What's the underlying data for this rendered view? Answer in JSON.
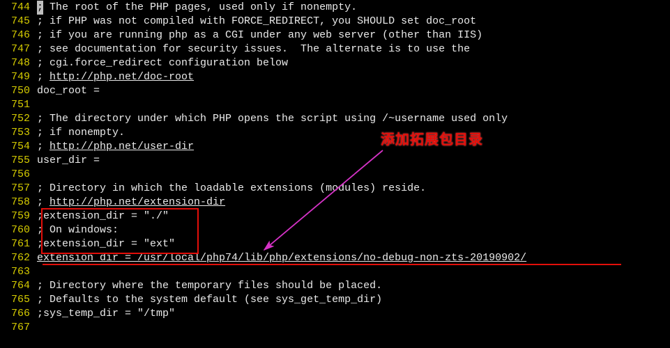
{
  "annotation": {
    "label": "添加拓展包目录"
  },
  "lines": [
    {
      "num": 744,
      "segments": [
        {
          "kind": "cursor",
          "text": ";"
        },
        {
          "kind": "comment",
          "text": " The root of the PHP pages, used only if nonempty."
        }
      ]
    },
    {
      "num": 745,
      "segments": [
        {
          "kind": "comment",
          "text": "; if PHP was not compiled with FORCE_REDIRECT, you SHOULD set doc_root"
        }
      ]
    },
    {
      "num": 746,
      "segments": [
        {
          "kind": "comment",
          "text": "; if you are running php as a CGI under any web server (other than IIS)"
        }
      ]
    },
    {
      "num": 747,
      "segments": [
        {
          "kind": "comment",
          "text": "; see documentation for security issues.  The alternate is to use the"
        }
      ]
    },
    {
      "num": 748,
      "segments": [
        {
          "kind": "comment",
          "text": "; cgi.force_redirect configuration below"
        }
      ]
    },
    {
      "num": 749,
      "segments": [
        {
          "kind": "comment",
          "text": "; "
        },
        {
          "kind": "link",
          "text": "http://php.net/doc-root"
        }
      ]
    },
    {
      "num": 750,
      "segments": [
        {
          "kind": "plain",
          "text": "doc_root ="
        }
      ]
    },
    {
      "num": 751,
      "segments": [
        {
          "kind": "plain",
          "text": ""
        }
      ]
    },
    {
      "num": 752,
      "segments": [
        {
          "kind": "comment",
          "text": "; The directory under which PHP opens the script using /~username used only"
        }
      ]
    },
    {
      "num": 753,
      "segments": [
        {
          "kind": "comment",
          "text": "; if nonempty."
        }
      ]
    },
    {
      "num": 754,
      "segments": [
        {
          "kind": "comment",
          "text": "; "
        },
        {
          "kind": "link",
          "text": "http://php.net/user-dir"
        }
      ]
    },
    {
      "num": 755,
      "segments": [
        {
          "kind": "plain",
          "text": "user_dir ="
        }
      ]
    },
    {
      "num": 756,
      "segments": [
        {
          "kind": "plain",
          "text": ""
        }
      ]
    },
    {
      "num": 757,
      "segments": [
        {
          "kind": "comment",
          "text": "; Directory in which the loadable extensions (modules) reside."
        }
      ]
    },
    {
      "num": 758,
      "segments": [
        {
          "kind": "comment",
          "text": "; "
        },
        {
          "kind": "link",
          "text": "http://php.net/extension-dir"
        }
      ]
    },
    {
      "num": 759,
      "segments": [
        {
          "kind": "comment",
          "text": ";extension_dir = \"./\""
        }
      ]
    },
    {
      "num": 760,
      "segments": [
        {
          "kind": "comment",
          "text": "; On windows:"
        }
      ]
    },
    {
      "num": 761,
      "segments": [
        {
          "kind": "comment",
          "text": ";extension_dir = \"ext\""
        }
      ]
    },
    {
      "num": 762,
      "segments": [
        {
          "kind": "ext",
          "text": "extension_dir = /usr/local/php74/lib/php/extensions/no-debug-non-zts-20190902/"
        }
      ]
    },
    {
      "num": 763,
      "segments": [
        {
          "kind": "plain",
          "text": ""
        }
      ]
    },
    {
      "num": 764,
      "segments": [
        {
          "kind": "comment",
          "text": "; Directory where the temporary files should be placed."
        }
      ]
    },
    {
      "num": 765,
      "segments": [
        {
          "kind": "comment",
          "text": "; Defaults to the system default (see sys_get_temp_dir)"
        }
      ]
    },
    {
      "num": 766,
      "segments": [
        {
          "kind": "comment",
          "text": ";sys_temp_dir = \"/tmp\""
        }
      ]
    },
    {
      "num": 767,
      "segments": [
        {
          "kind": "plain",
          "text": ""
        }
      ]
    }
  ]
}
